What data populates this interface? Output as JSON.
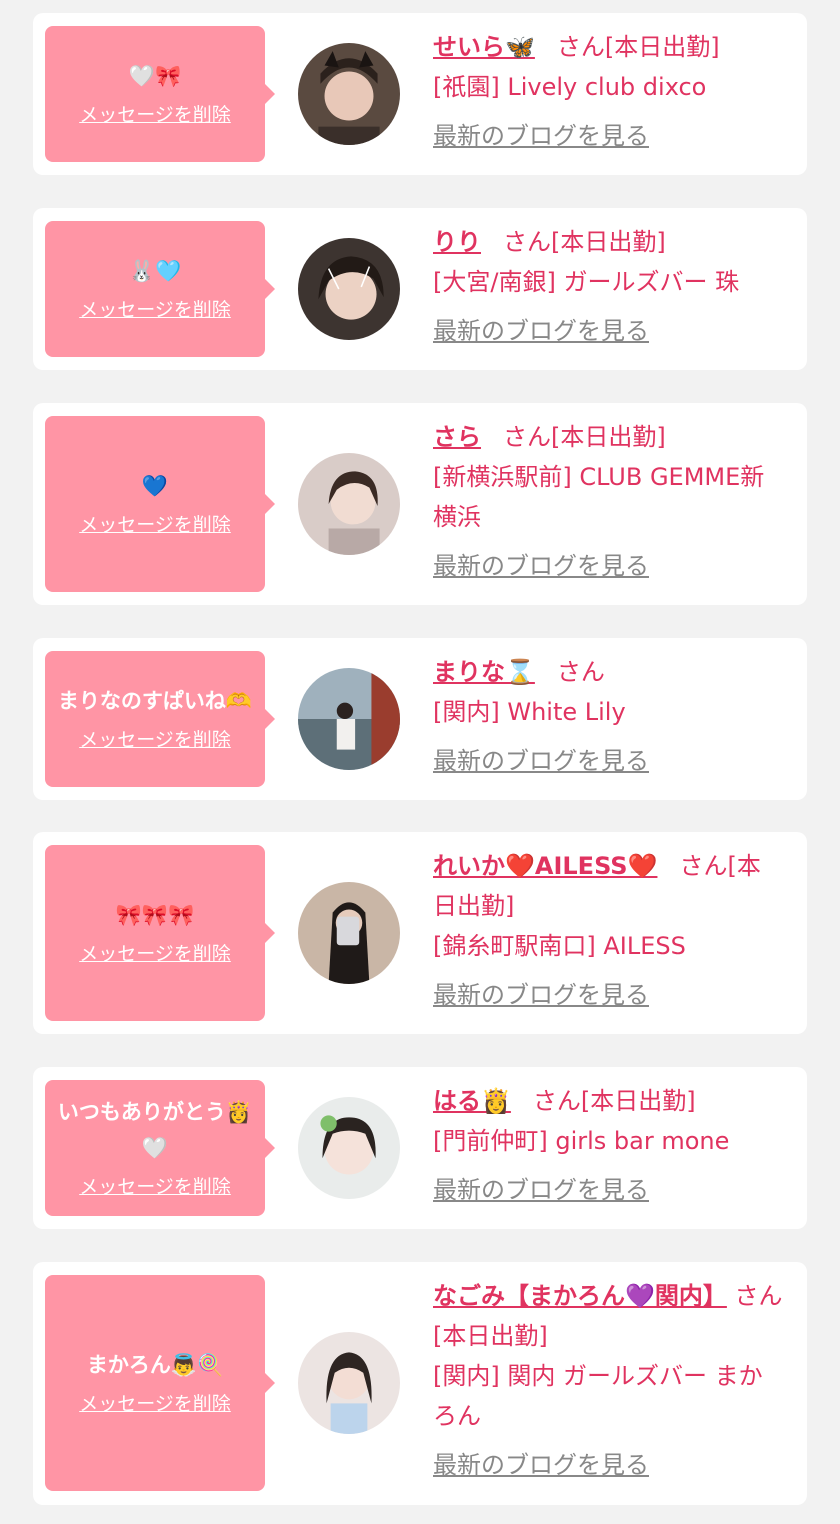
{
  "accent": "#e03360",
  "bubble_color": "#ff95a5",
  "delete_label": "メッセージを削除",
  "blog_label": "最新のブログを見る",
  "entries": [
    {
      "message": "🤍🎀",
      "name": "せいら🦋",
      "status": "さん[本日出勤]",
      "shop": "[祇園] Lively club dixco"
    },
    {
      "message": "🐰🩵",
      "name": "りり",
      "status": "さん[本日出勤]",
      "shop": "[大宮/南銀] ガールズバー 珠"
    },
    {
      "message": "💙",
      "name": "さら",
      "status": "さん[本日出勤]",
      "shop": "[新横浜駅前] CLUB GEMME新横浜"
    },
    {
      "message": "まりなのすぱいね🫶",
      "name": "まりな⌛",
      "status": "さん",
      "shop": "[関内] White Lily"
    },
    {
      "message": "🎀🎀🎀",
      "name": "れいか❤️AILESS❤️",
      "status": "さん[本日出勤]",
      "shop": "[錦糸町駅南口] AILESS"
    },
    {
      "message": "いつもありがとう👸🤍",
      "name": "はる👸",
      "status": "さん[本日出勤]",
      "shop": "[門前仲町] girls bar mone"
    },
    {
      "message": "まかろん👼🍭",
      "name": "なごみ【まかろん💜関内】",
      "status": "さん[本日出勤]",
      "shop": "[関内] 関内 ガールズバー まかろん"
    }
  ]
}
